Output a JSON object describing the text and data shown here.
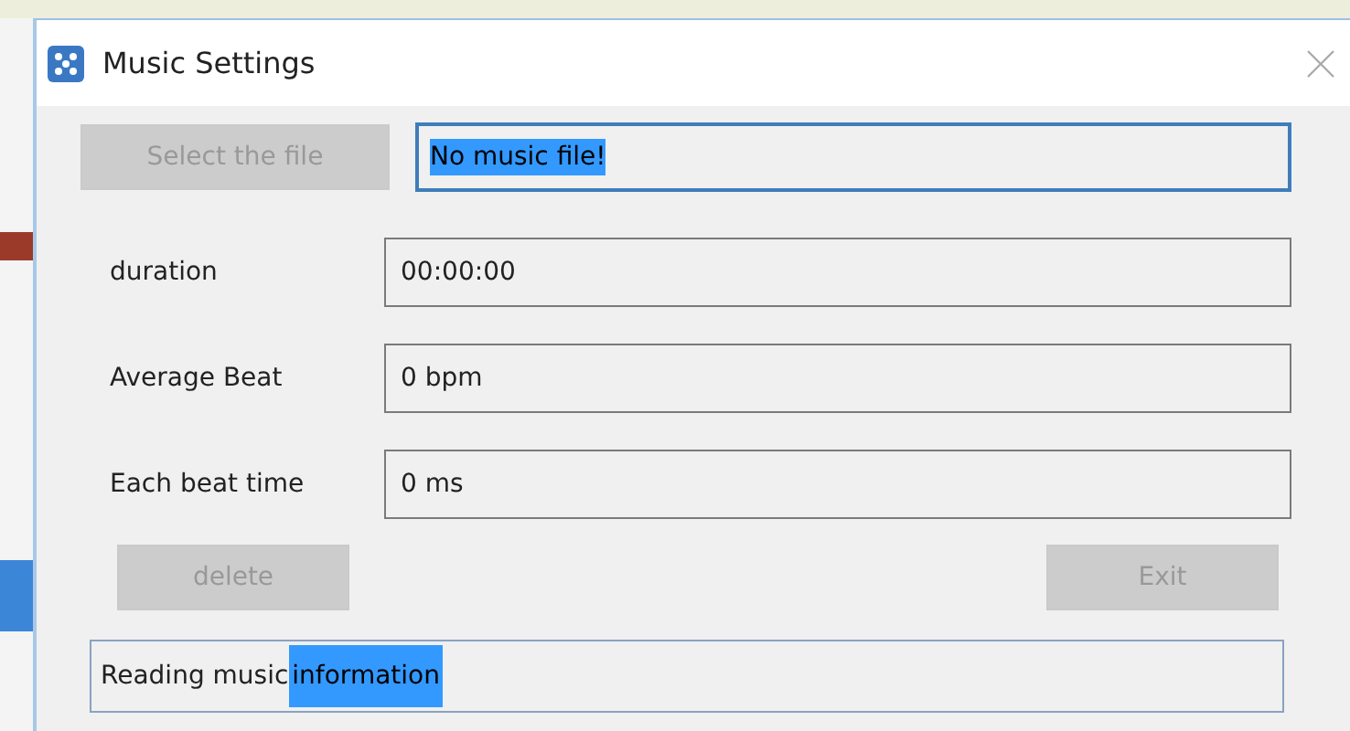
{
  "window": {
    "title": "Music Settings"
  },
  "file_row": {
    "button": {
      "label": "Select the file",
      "disabled": true
    },
    "field": {
      "value": "No music file!",
      "selected": true
    }
  },
  "fields": [
    {
      "label": "duration",
      "value": "00:00:00",
      "selected": false
    },
    {
      "label": "Average Beat",
      "value": "0  bpm",
      "selected": false
    },
    {
      "label": "Each beat time",
      "value": "0  ms",
      "selected": false
    }
  ],
  "buttons": [
    {
      "label": "delete",
      "disabled": true
    },
    {
      "label": "Exit",
      "disabled": true
    }
  ],
  "status_bar": {
    "parts": [
      {
        "text": "Reading music",
        "selected": false
      },
      {
        "text": "information",
        "selected": true
      }
    ]
  }
}
